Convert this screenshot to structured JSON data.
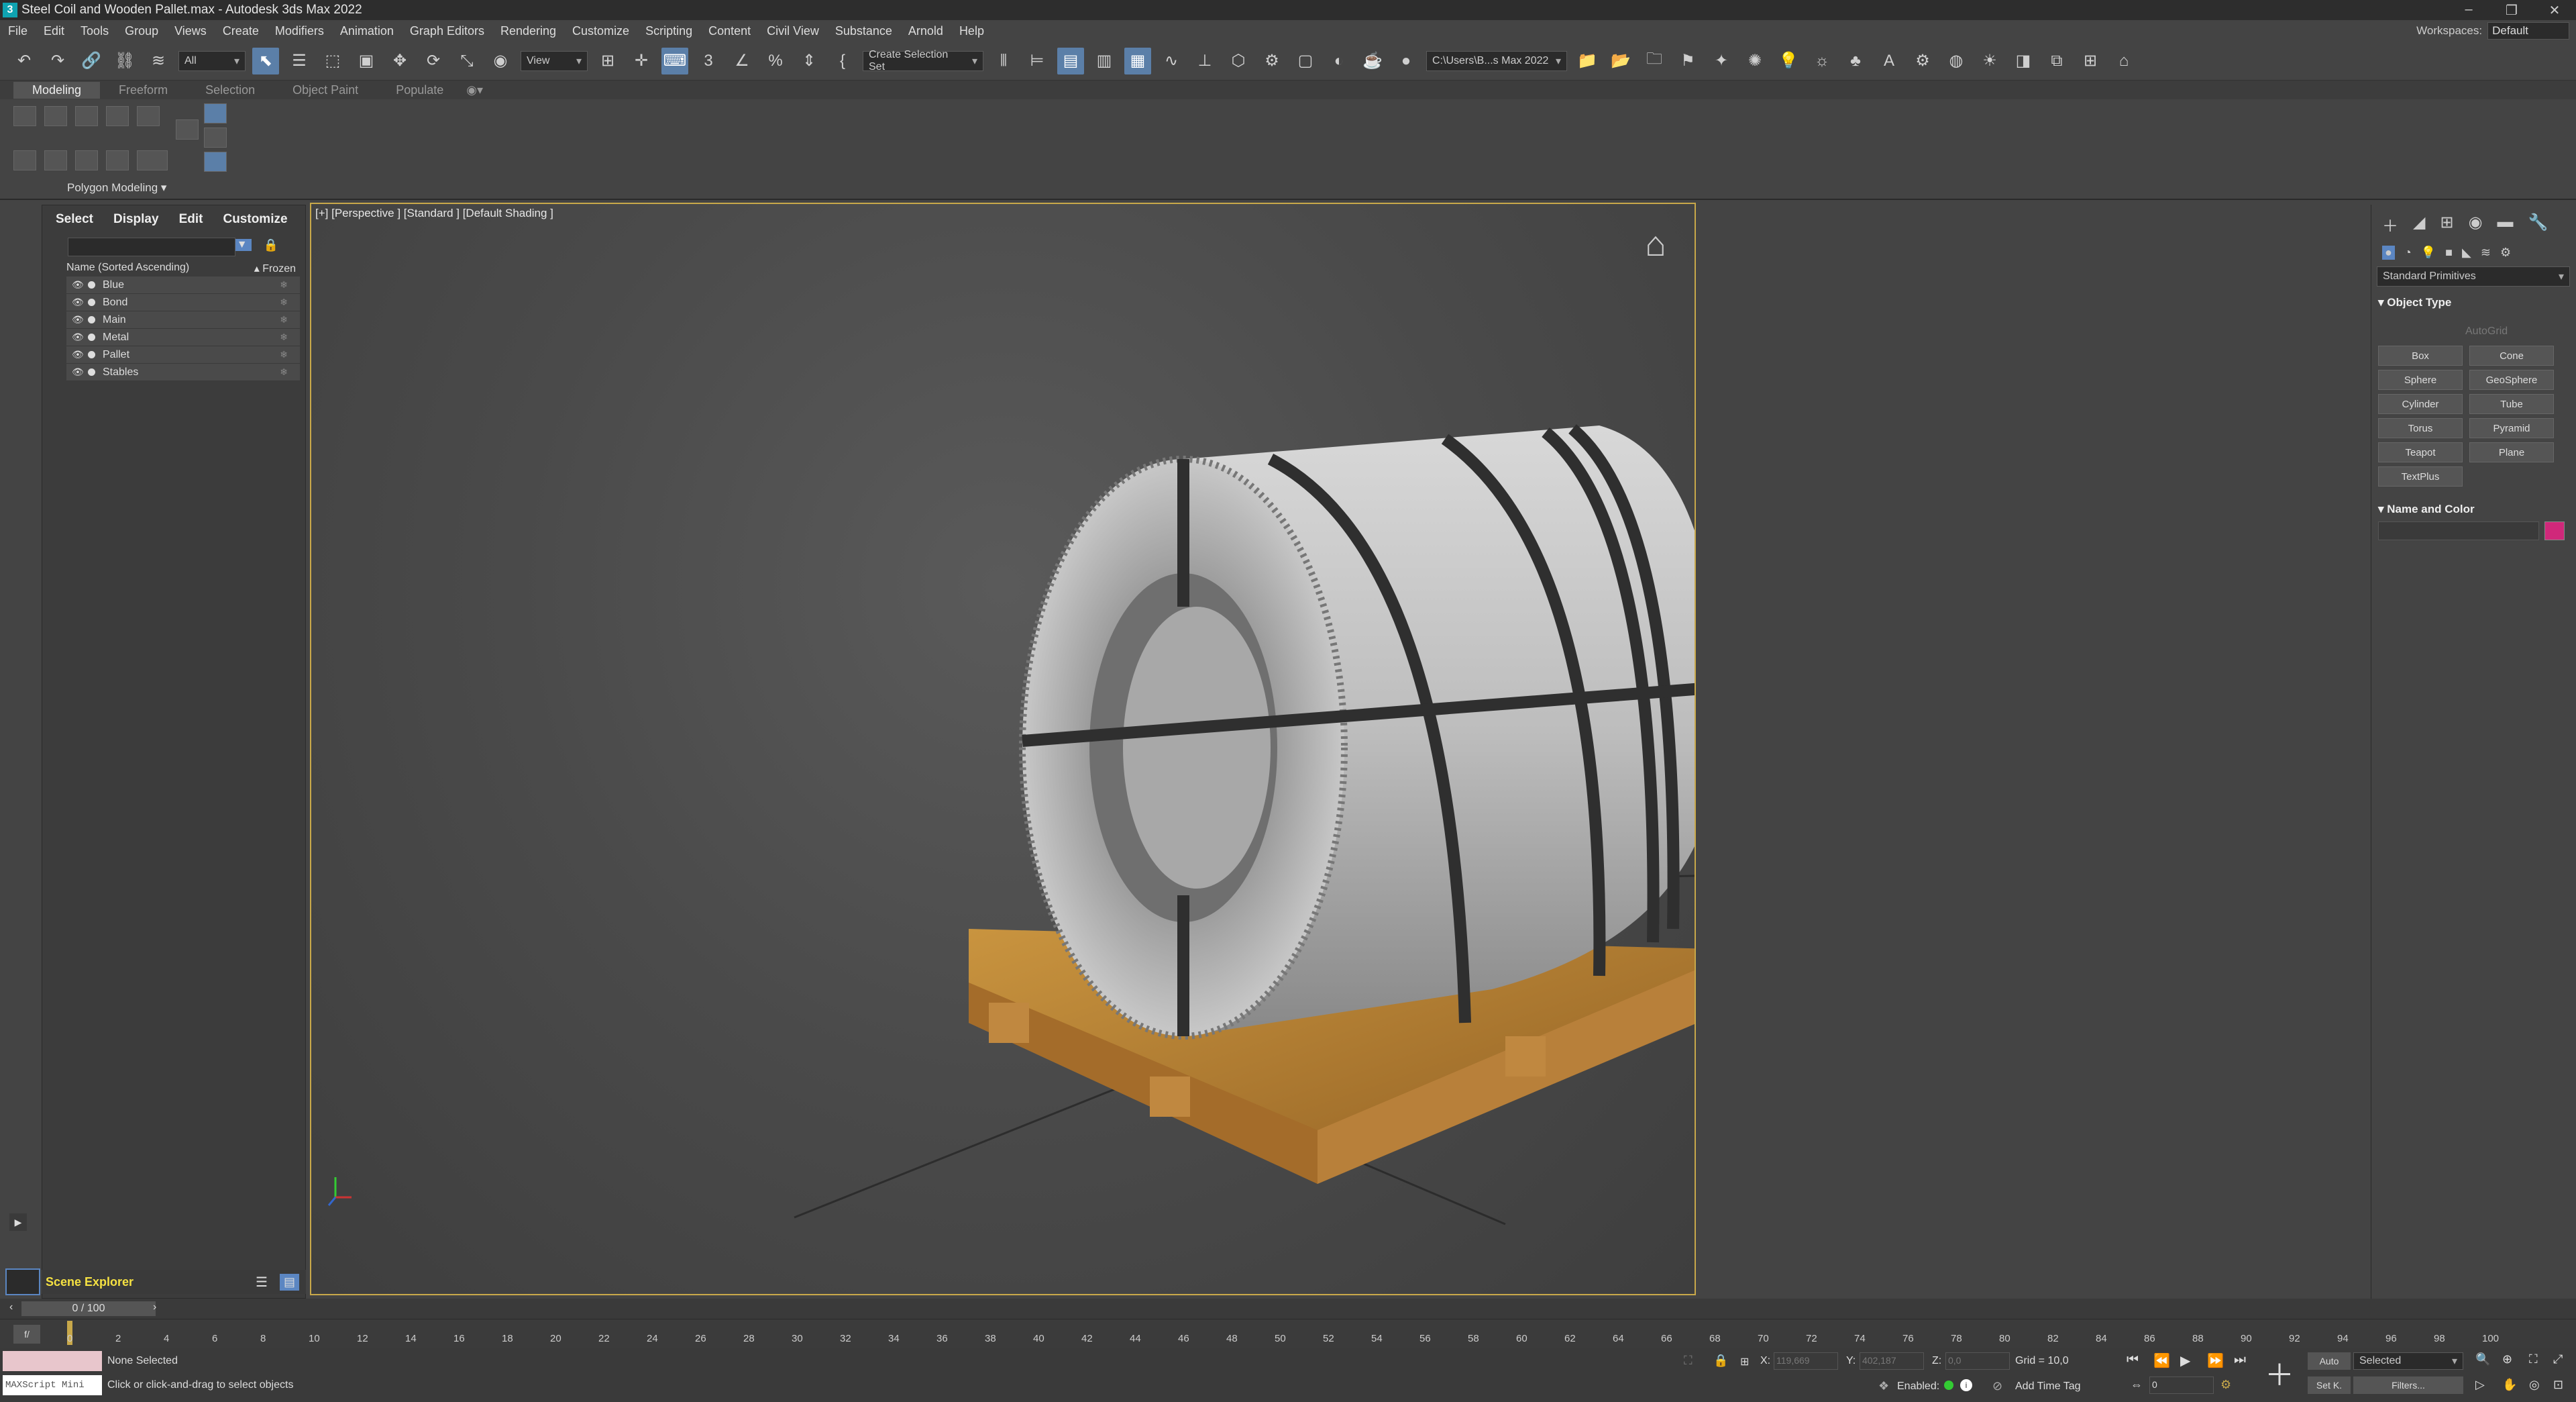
{
  "app": {
    "title": "Steel Coil and Wooden Pallet.max - Autodesk 3ds Max 2022",
    "workspace_label": "Workspaces:",
    "workspace_value": "Default"
  },
  "menu": [
    "File",
    "Edit",
    "Tools",
    "Group",
    "Views",
    "Create",
    "Modifiers",
    "Animation",
    "Graph Editors",
    "Rendering",
    "Customize",
    "Scripting",
    "Content",
    "Civil View",
    "Substance",
    "Arnold",
    "Help"
  ],
  "toolbar": {
    "filter_value": "All",
    "ref_coord": "View",
    "selection_set": "Create Selection Set",
    "project_path": "C:\\Users\\B...s Max 2022"
  },
  "ribbon": {
    "tabs": [
      "Modeling",
      "Freeform",
      "Selection",
      "Object Paint",
      "Populate"
    ],
    "panel_label": "Polygon Modeling ▾"
  },
  "scene_explorer": {
    "tabs": [
      "Select",
      "Display",
      "Edit",
      "Customize"
    ],
    "column_header": "Name (Sorted Ascending)",
    "frozen_header": "▴ Frozen",
    "objects": [
      "Blue",
      "Bond",
      "Main",
      "Metal",
      "Pallet",
      "Stables"
    ],
    "footer_label": "Scene Explorer"
  },
  "viewport": {
    "label": "[+] [Perspective ] [Standard ] [Default Shading ]"
  },
  "command_panel": {
    "category": "Standard Primitives",
    "object_type_title": "Object Type",
    "autogrid": "AutoGrid",
    "buttons": [
      "Box",
      "Cone",
      "Sphere",
      "GeoSphere",
      "Cylinder",
      "Tube",
      "Torus",
      "Pyramid",
      "Teapot",
      "Plane",
      "TextPlus"
    ],
    "name_color_title": "Name and Color",
    "swatch_color": "#d0287a"
  },
  "timeline": {
    "frame_display": "0 / 100",
    "ticks": [
      "0",
      "2",
      "4",
      "6",
      "8",
      "10",
      "12",
      "14",
      "16",
      "18",
      "20",
      "22",
      "24",
      "26",
      "28",
      "30",
      "32",
      "34",
      "36",
      "38",
      "40",
      "42",
      "44",
      "46",
      "48",
      "50",
      "52",
      "54",
      "56",
      "58",
      "60",
      "62",
      "64",
      "66",
      "68",
      "70",
      "72",
      "74",
      "76",
      "78",
      "80",
      "82",
      "84",
      "86",
      "88",
      "90",
      "92",
      "94",
      "96",
      "98",
      "100"
    ]
  },
  "status": {
    "selection": "None Selected",
    "prompt": "Click or click-and-drag to select objects",
    "maxscript": "MAXScript Mini",
    "x_label": "X:",
    "x_value": "119,669",
    "y_label": "Y:",
    "y_value": "402,187",
    "z_label": "Z:",
    "z_value": "0,0",
    "grid": "Grid = 10,0",
    "enabled": "Enabled:",
    "add_time_tag": "Add Time Tag",
    "auto": "Auto",
    "set_key": "Set K.",
    "key_mode": "Selected",
    "filters": "Filters...",
    "current_frame": "0"
  }
}
